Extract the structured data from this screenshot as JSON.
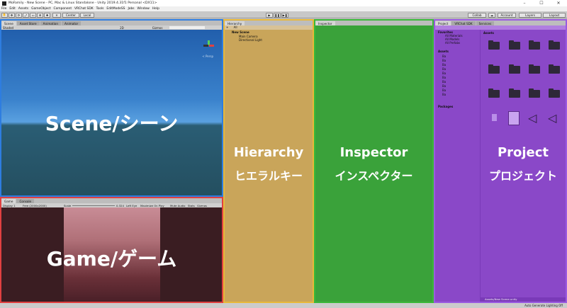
{
  "window": {
    "title": "MoFamily - New Scene - PC, Mac & Linux Standalone - Unity 2019.4.31f1 Personal <DX11>"
  },
  "menu": [
    "File",
    "Edit",
    "Assets",
    "GameObject",
    "Component",
    "VRChat SDK",
    "Tools",
    "EditModeSS",
    "Jobs",
    "Window",
    "Help"
  ],
  "toolbar": {
    "pivot": "Center",
    "space": "Local",
    "collab": "Collab",
    "account": "Account",
    "layers": "Layers",
    "layout": "Layout"
  },
  "scene": {
    "tabs": [
      "Scene",
      "Asset Store",
      "Animation",
      "Animator"
    ],
    "shading": "Shaded",
    "mode": "2D",
    "gizmos": "Gizmos",
    "persp": "< Persp",
    "label": "Scene/シーン",
    "colors": {
      "sky": "#2f6fb8",
      "ground": "#28566e",
      "border": "#2e7de0"
    }
  },
  "game": {
    "tabs": [
      "Game",
      "Console"
    ],
    "display": "Display 1",
    "resolution": "Free (2000x2000)",
    "scale_label": "Scale",
    "scale_value": "0.324",
    "eye": "Left Eye",
    "toggles": [
      "Maximize On Play",
      "Mute Audio",
      "Stats",
      "Gizmos"
    ],
    "label": "Game/ゲーム",
    "colors": {
      "bg": "#3a1d22",
      "border": "#e04040"
    }
  },
  "hierarchy": {
    "tab": "Hierarchy",
    "create": "+",
    "search": "All",
    "scene": "New Scene",
    "items": [
      "Main Camera",
      "Directional Light"
    ],
    "label_en": "Hierarchy",
    "label_ja": "ヒエラルキー",
    "colors": {
      "bg": "#c9a55a",
      "border": "#e8b83a"
    }
  },
  "inspector": {
    "tab": "Inspector",
    "label_en": "Inspector",
    "label_ja": "インスペクター",
    "colors": {
      "bg": "#3aa23a",
      "border": "#3ab83a"
    }
  },
  "project": {
    "tabs": [
      "Project",
      "VRChat SDK",
      "Services"
    ],
    "favorites_title": "Favorites",
    "favorites": [
      "All Materials",
      "All Models",
      "All Prefabs"
    ],
    "assets_title": "Assets",
    "assets_items": [
      "Ba",
      "Ba",
      "Ba",
      "Ba",
      "Ba",
      "Ba",
      "Ba",
      "Ba",
      "Ba",
      "Ba"
    ],
    "packages": "Packages",
    "grid_title": "Assets",
    "path": "Assets/New Scene.unity",
    "label_en": "Project",
    "label_ja": "プロジェクト",
    "colors": {
      "bg": "#8a48c8",
      "border": "#9a5ae0"
    }
  },
  "status": {
    "text": "Auto Generate Lighting Off"
  }
}
